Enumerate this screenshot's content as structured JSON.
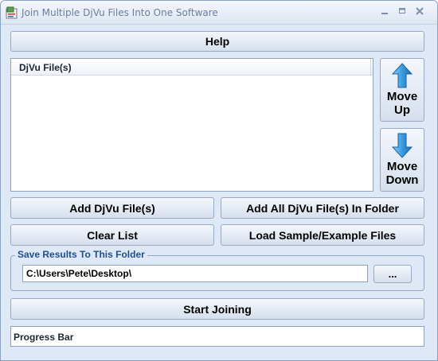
{
  "window": {
    "title": "Join Multiple DjVu Files Into One Software",
    "app_icon": "app-icon",
    "controls": [
      "minimize-icon",
      "maximize-icon",
      "close-icon"
    ]
  },
  "toolbar": {
    "help_label": "Help"
  },
  "file_list": {
    "columns": [
      "DjVu File(s)"
    ],
    "rows": []
  },
  "move": {
    "up_line1": "Move",
    "up_line2": "Up",
    "up_icon": "arrow-up-icon",
    "down_line1": "Move",
    "down_line2": "Down",
    "down_icon": "arrow-down-icon"
  },
  "actions": {
    "add_label": "Add DjVu File(s)",
    "add_folder_label": "Add All DjVu File(s) In Folder",
    "clear_label": "Clear List",
    "sample_label": "Load Sample/Example Files"
  },
  "save": {
    "legend": "Save Results To This Folder",
    "folder_value": "C:\\Users\\Pete\\Desktop\\",
    "browse_label": "..."
  },
  "start": {
    "label": "Start Joining"
  },
  "progress": {
    "label": "Progress Bar",
    "value": 0
  },
  "colors": {
    "window_bg": "#dfe8f6",
    "arrow_blue": "#3a9be0",
    "legend_blue": "#1f4f8f"
  }
}
